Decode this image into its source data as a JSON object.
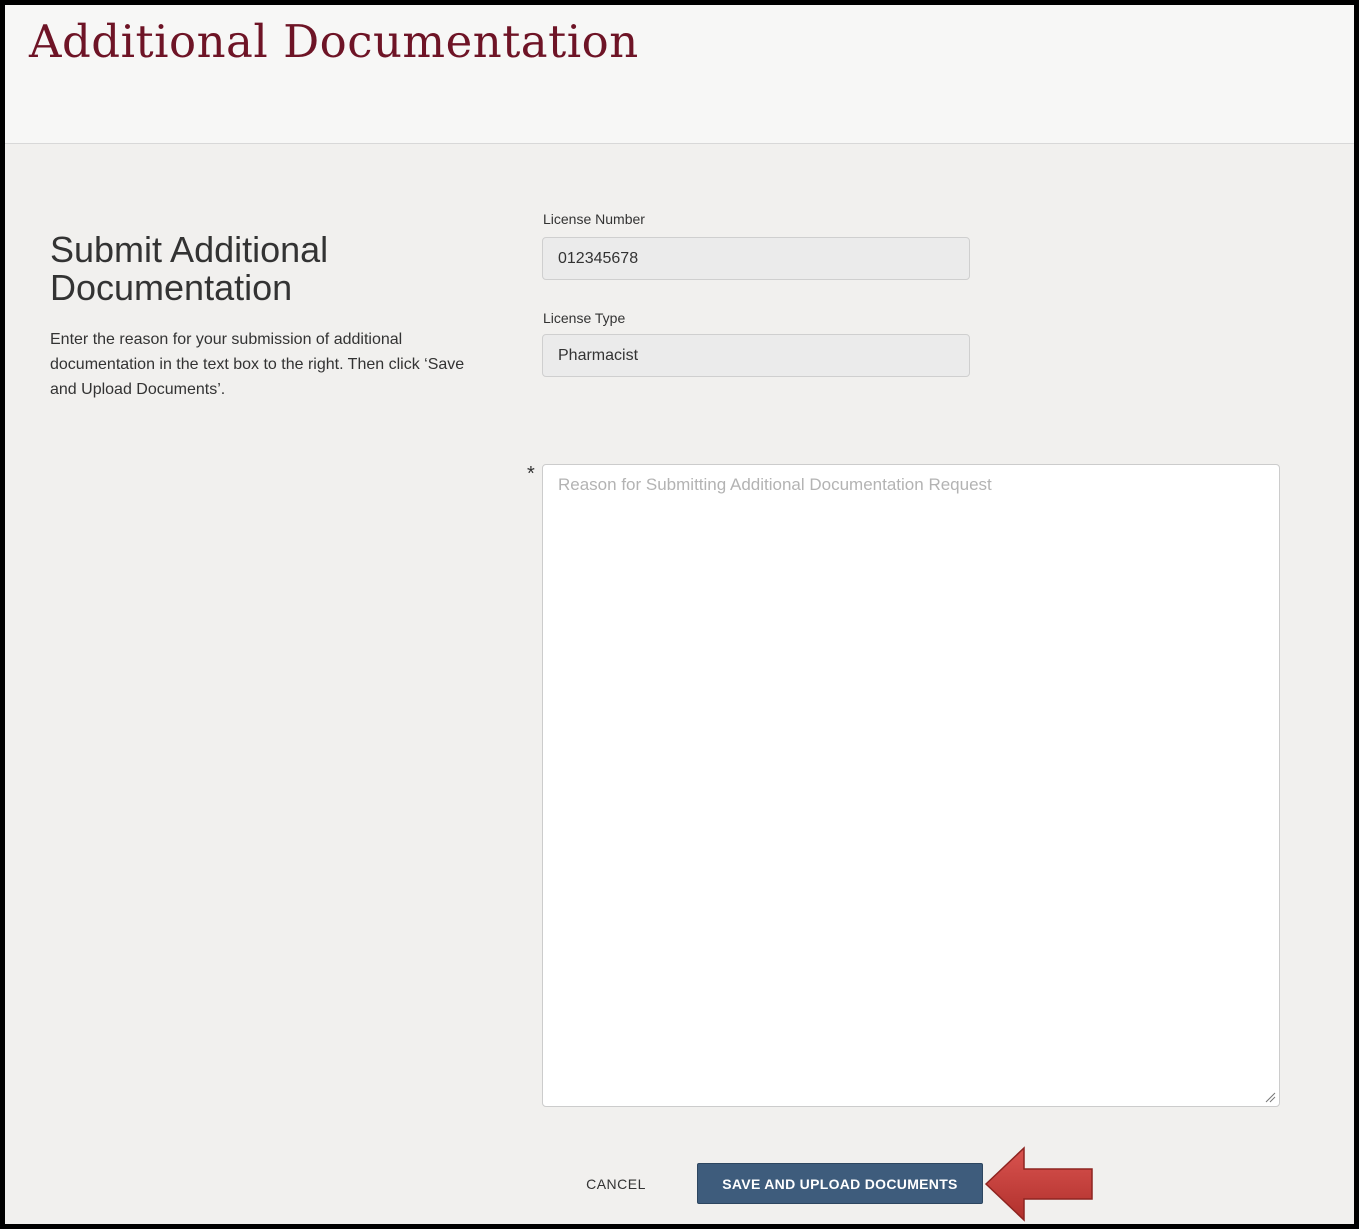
{
  "header": {
    "title": "Additional Documentation"
  },
  "intro": {
    "title": "Submit Additional Documentation",
    "description": "Enter the reason for your submission of additional documentation in the text box to the right. Then click ‘Save and Upload Documents’."
  },
  "form": {
    "license_number": {
      "label": "License Number",
      "value": "012345678"
    },
    "license_type": {
      "label": "License Type",
      "value": "Pharmacist"
    },
    "reason": {
      "required_marker": "*",
      "placeholder": "Reason for Submitting Additional Documentation Request",
      "value": ""
    }
  },
  "actions": {
    "cancel_label": "CANCEL",
    "save_label": "SAVE AND UPLOAD DOCUMENTS"
  },
  "colors": {
    "title": "#6e1426",
    "primary_button": "#3e5c7c",
    "callout_arrow": "#c0392b",
    "page_background": "#f1f0ee"
  },
  "icons": {
    "resize_handle": "resize-grip-icon",
    "callout": "arrow-left-icon"
  }
}
